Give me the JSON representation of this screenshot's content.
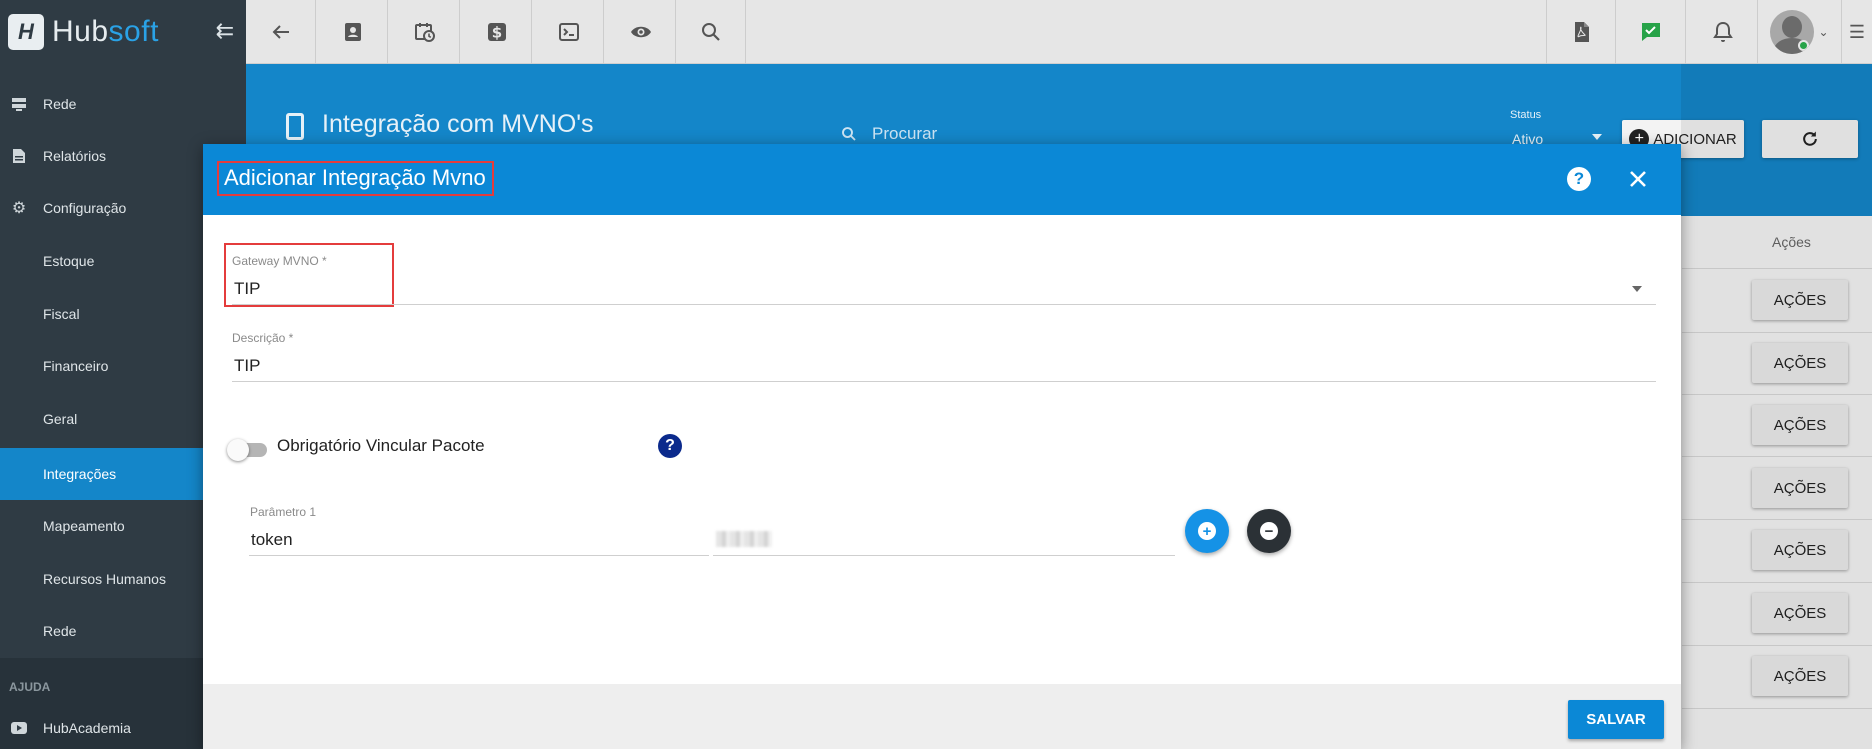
{
  "app": {
    "logo_letter": "H",
    "logo_hub": "Hub",
    "logo_soft": "soft"
  },
  "topbar": {
    "icons": [
      "back-arrow-icon",
      "contact-card-icon",
      "calendar-clock-icon",
      "dollar-icon",
      "terminal-icon",
      "eye-icon",
      "search-icon",
      "pdf-icon",
      "chat-check-icon",
      "bell-icon",
      "user-avatar",
      "menu-list-icon"
    ],
    "accent_chat": "#27a348"
  },
  "sidebar": {
    "items": [
      {
        "label": "Rede",
        "icon": "server-icon"
      },
      {
        "label": "Relatórios",
        "icon": "document-icon"
      },
      {
        "label": "Configuração",
        "icon": "gear-icon"
      },
      {
        "label": "Estoque"
      },
      {
        "label": "Fiscal"
      },
      {
        "label": "Financeiro"
      },
      {
        "label": "Geral"
      },
      {
        "label": "Integrações",
        "active": true
      },
      {
        "label": "Mapeamento"
      },
      {
        "label": "Recursos Humanos"
      },
      {
        "label": "Rede"
      }
    ],
    "section_label": "AJUDA",
    "help_item": {
      "label": "HubAcademia",
      "icon": "youtube-icon"
    },
    "active_color": "#1486c9"
  },
  "page": {
    "title": "Integração com MVNO's",
    "search_placeholder": "Procurar",
    "status_label": "Status",
    "status_value": "Ativo",
    "add_button": "ADICIONAR",
    "table": {
      "actions_header": "Ações",
      "row_actions": [
        "AÇÕES",
        "AÇÕES",
        "AÇÕES",
        "AÇÕES",
        "AÇÕES",
        "AÇÕES",
        "AÇÕES"
      ]
    }
  },
  "modal": {
    "title": "Adicionar Integração Mvno",
    "gateway": {
      "label": "Gateway MVNO *",
      "value": "TIP"
    },
    "descricao": {
      "label": "Descrição *",
      "value": "TIP"
    },
    "toggle": {
      "label": "Obrigatório Vincular Pacote",
      "checked": false
    },
    "param": {
      "label": "Parâmetro 1",
      "key": "token"
    },
    "save_button": "SALVAR",
    "header_color": "#0b88d6",
    "highlight_color": "#e43c3c"
  }
}
